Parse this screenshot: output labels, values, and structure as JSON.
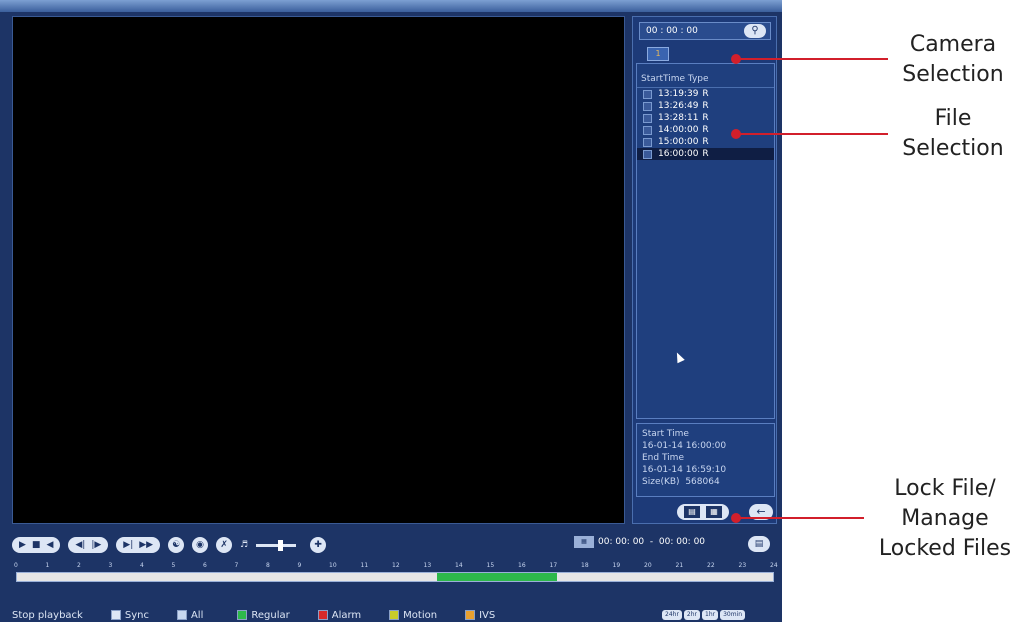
{
  "panel": {
    "time": "00 : 00 : 00",
    "search_icon": "search-icon",
    "camera_tab": "1"
  },
  "files": {
    "header": "StartTime Type",
    "rows": [
      {
        "time": "13:19:39",
        "type": "R"
      },
      {
        "time": "13:26:49",
        "type": "R"
      },
      {
        "time": "13:28:11",
        "type": "R"
      },
      {
        "time": "14:00:00",
        "type": "R"
      },
      {
        "time": "15:00:00",
        "type": "R"
      },
      {
        "time": "16:00:00",
        "type": "R"
      }
    ]
  },
  "info": {
    "start_label": "Start Time",
    "start_value": "16-01-14  16:00:00",
    "end_label": "End Time",
    "end_value": "16-01-14  16:59:10",
    "size_label": "Size(KB)",
    "size_value": "568064"
  },
  "controls": {
    "range_start": "00: 00: 00",
    "range_sep": "-",
    "range_end": "00: 00: 00",
    "ticks": [
      "0",
      "1",
      "2",
      "3",
      "4",
      "5",
      "6",
      "7",
      "8",
      "9",
      "10",
      "11",
      "12",
      "13",
      "14",
      "15",
      "16",
      "17",
      "18",
      "19",
      "20",
      "21",
      "22",
      "23",
      "24"
    ],
    "stop_label": "Stop playback",
    "sync_label": "Sync",
    "filters": [
      {
        "label": "All",
        "color": "#c8d8f0"
      },
      {
        "label": "Regular",
        "color": "#2db84a"
      },
      {
        "label": "Alarm",
        "color": "#d62a2a"
      },
      {
        "label": "Motion",
        "color": "#c8cc2a"
      },
      {
        "label": "IVS",
        "color": "#e8a030"
      }
    ],
    "zoom": [
      "24hr",
      "2hr",
      "1hr",
      "30min"
    ]
  },
  "callouts": {
    "camera": [
      "Camera",
      "Selection"
    ],
    "file": [
      "File",
      "Selection"
    ],
    "lock": [
      "Lock File/",
      "Manage",
      "Locked Files"
    ]
  }
}
